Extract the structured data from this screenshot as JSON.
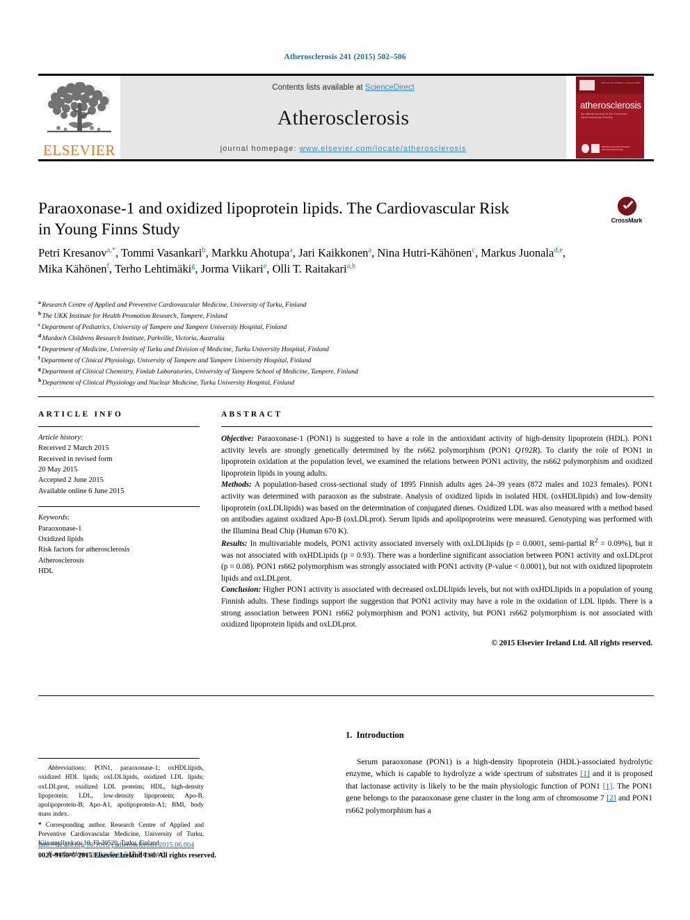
{
  "running_head": "Atherosclerosis 241 (2015) 502–506",
  "masthead": {
    "logo_word": "ELSEVIER",
    "contents_prefix": "Contents lists available at ",
    "contents_link": "ScienceDirect",
    "journal_name": "Atherosclerosis",
    "homepage_prefix": "journal homepage: ",
    "homepage_url": "www.elsevier.com/locate/atherosclerosis",
    "cover_title": "atherosclerosis",
    "cover_subtitle": "An official journal of the European Atherosclerosis Society",
    "cover_topwords": "Volume 241  Number 2  August 2015",
    "cover_badge_text": "Official journal of the\nEuropean Atherosclerosis Society"
  },
  "article": {
    "title": "Paraoxonase-1 and oxidized lipoprotein lipids. The Cardiovascular Risk in Young Finns Study",
    "crossmark_label": "CrossMark",
    "authors_line_1": "Petri Kresanov",
    "authors_plain": "Petri Kresanov a,*, Tommi Vasankari b, Markku Ahotupa a, Jari Kaikkonen a, Nina Hutri-Kähönen c, Markus Juonala d,e, Mika Kähönen f, Terho Lehtimäki g, Jorma Viikari e, Olli T. Raitakari a,h",
    "authors": [
      {
        "name": "Petri Kresanov",
        "marks": "a,",
        "star": true,
        "comma": true
      },
      {
        "name": "Tommi Vasankari",
        "marks": "b",
        "comma": true
      },
      {
        "name": "Markku Ahotupa",
        "marks": "a",
        "comma": true
      },
      {
        "name": "Jari Kaikkonen",
        "marks": "a",
        "comma": true
      },
      {
        "name": "Nina Hutri-Kähönen",
        "marks": "c",
        "comma": true
      },
      {
        "name": "Markus Juonala",
        "marks": "d,e",
        "comma": true
      },
      {
        "name": "Mika Kähönen",
        "marks": "f",
        "comma": true
      },
      {
        "name": "Terho Lehtimäki",
        "marks": "g",
        "comma": true
      },
      {
        "name": "Jorma Viikari",
        "marks": "e",
        "comma": true
      },
      {
        "name": "Olli T. Raitakari",
        "marks": "a,h",
        "comma": false
      }
    ],
    "affiliations": [
      {
        "mark": "a",
        "text": "Research Centre of Applied and Preventive Cardiovascular Medicine, University of Turku, Finland"
      },
      {
        "mark": "b",
        "text": "The UKK Institute for Health Promotion Research, Tampere, Finland"
      },
      {
        "mark": "c",
        "text": "Department of Pediatrics, University of Tampere and Tampere University Hospital, Finland"
      },
      {
        "mark": "d",
        "text": "Murdoch Childrens Research Institute, Parkville, Victoria, Australia"
      },
      {
        "mark": "e",
        "text": "Department of Medicine, University of Turku and Division of Medicine, Turku University Hospital, Finland"
      },
      {
        "mark": "f",
        "text": "Department of Clinical Physiology, University of Tampere and Tampere University Hospital, Finland"
      },
      {
        "mark": "g",
        "text": "Department of Clinical Chemistry, Fimlab Laboratories, University of Tampere School of Medicine, Tampere, Finland"
      },
      {
        "mark": "h",
        "text": "Department of Clinical Physiology and Nuclear Medicine, Turku University Hospital, Finland"
      }
    ]
  },
  "info": {
    "heading": "ARTICLE INFO",
    "history_label": "Article history:",
    "history": [
      "Received 2 March 2015",
      "Received in revised form",
      "20 May 2015",
      "Accepted 2 June 2015",
      "Available online 6 June 2015"
    ],
    "keywords_label": "Keywords:",
    "keywords": [
      "Paraoxonase-1",
      "Oxidized lipids",
      "Risk factors for atherosclerosis",
      "Atherosclerosis",
      "HDL"
    ]
  },
  "abstract": {
    "heading": "ABSTRACT",
    "objective_label": "Objective:",
    "objective_text": " Paraoxonase-1 (PON1) is suggested to have a role in the antioxidant activity of high-density lipoprotein (HDL). PON1 activity levels are strongly genetically determined by the rs662 polymorphism (PON1 ",
    "objective_italic": "Q192R",
    "objective_text2": "). To clarify the role of PON1 in lipoprotein oxidation at the population level, we examined the relations between PON1 activity, the rs662 polymorphism and oxidized lipoprotein lipids in young adults.",
    "methods_label": "Methods:",
    "methods_text": " A population-based cross-sectional study of 1895 Finnish adults ages 24–39 years (872 males and 1023 females). PON1 activity was determined with paraoxon as the substrate. Analysis of oxidized lipids in isolated HDL (oxHDLlipids) and low-density lipoprotein (oxLDLlipids) was based on the determination of conjugated dienes. Oxidized LDL was also measured with a method based on antibodies against oxidized Apo-B (oxLDLprot). Serum lipids and apolipoproteins were measured. Genotyping was performed with the Illumina Bead Chip (Human 670 K).",
    "results_label": "Results:",
    "results_text": " In multivariable models, PON1 activity associated inversely with oxLDLlipids (p = 0.0001, semi-partial R",
    "results_sup": "2",
    "results_text2": " = 0.09%), but it was not associated with oxHDLipids (p = 0.93). There was a borderline significant association between PON1 activity and oxLDLprot (p = 0.08). PON1 rs662 polymorphism was strongly associated with PON1 activity (P-value < 0.0001), but not with oxidized lipoprotein lipids and oxLDLprot.",
    "conclusion_label": "Conclusion:",
    "conclusion_text": " Higher PON1 activity is associated with decreased oxLDLlipids levels, but not with oxHDLlipids in a population of young Finnish adults. These findings support the suggestion that PON1 activity may have a role in the oxidation of LDL lipids. There is a strong association between PON1 rs662 polymorphism and PON1 activity, but PON1 rs662 polymorphism is not associated with oxidized lipoprotein lipids and oxLDLprot.",
    "copyright": "© 2015 Elsevier Ireland Ltd. All rights reserved."
  },
  "footnotes": {
    "abbrev_label": "Abbreviations:",
    "abbrev_text": " PON1, paraoxonase-1; oxHDLlipids, oxidized HDL lipids; oxLDLlipids, oxidized LDL lipids; oxLDLprot, oxidized LDL proteins; HDL, high-density lipoprotein; LDL, low-density lipoprotein; Apo-B, apolipoprotein-B; Apo-A1, apolipoprotein-A1; BMI, body mass index.",
    "corresponding_marker": "*",
    "corresponding_text": " Corresponding author. Research Centre of Applied and Preventive Cardiovascular Medicine, University of Turku, Kiinamyllynkatu 10, FI-20520, Turku, Finland.",
    "email_label": "E-mail address:",
    "email": "ppakre@utu.fi",
    "email_suffix": " (P. Kresanov)."
  },
  "footer": {
    "doi": "http://dx.doi.org/10.1016/j.atherosclerosis.2015.06.004",
    "issn_line": "0021-9150/© 2015 Elsevier Ireland Ltd. All rights reserved."
  },
  "introduction": {
    "number": "1.",
    "heading": "Introduction",
    "p1_a": "Serum paraoxonase (PON1) is a high-density lipoprotein (HDL)-associated hydrolytic enzyme, which is capable to hydrolyze a wide spectrum of substrates ",
    "ref1": "[1]",
    "p1_b": " and it is proposed that lactonase activity is likely to be the main physiologic function of PON1 ",
    "ref2": "[1]",
    "p1_c": ". The PON1 gene belongs to the paraoxonase gene cluster in the long arm of chromosome 7 ",
    "ref3": "[2]",
    "p1_d": " and PON1 rs662 polymorphism has a"
  },
  "colors": {
    "link_blue": "#1a6a9b",
    "sciencedirect_blue": "#2b8cc4",
    "elsevier_orange": "#e87722",
    "cover_red": "#8c1520",
    "masthead_grey": "#e6e6e6"
  }
}
